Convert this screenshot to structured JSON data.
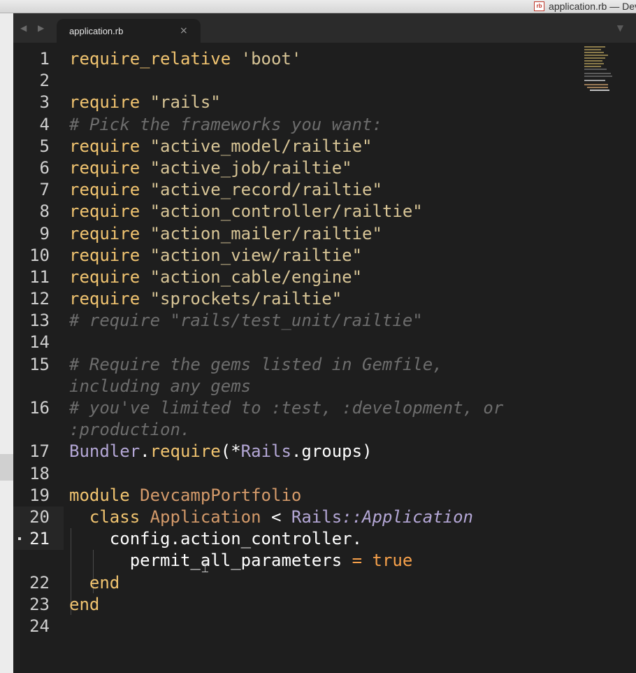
{
  "window": {
    "title": "application.rb — Devc",
    "file_badge": "rb"
  },
  "tabbar": {
    "nav_arrows": "◀ ▶",
    "tab_label": "application.rb",
    "tab_close": "×",
    "menu": "▼"
  },
  "code": {
    "l1": {
      "num": "1",
      "a": "require_relative",
      "b": " 'boot'"
    },
    "l2": {
      "num": "2"
    },
    "l3": {
      "num": "3",
      "a": "require",
      "b": " \"rails\""
    },
    "l4": {
      "num": "4",
      "c": "# Pick the frameworks you want:"
    },
    "l5": {
      "num": "5",
      "a": "require",
      "b": " \"active_model/railtie\""
    },
    "l6": {
      "num": "6",
      "a": "require",
      "b": " \"active_job/railtie\""
    },
    "l7": {
      "num": "7",
      "a": "require",
      "b": " \"active_record/railtie\""
    },
    "l8": {
      "num": "8",
      "a": "require",
      "b": " \"action_controller/railtie\""
    },
    "l9": {
      "num": "9",
      "a": "require",
      "b": " \"action_mailer/railtie\""
    },
    "l10": {
      "num": "10",
      "a": "require",
      "b": " \"action_view/railtie\""
    },
    "l11": {
      "num": "11",
      "a": "require",
      "b": " \"action_cable/engine\""
    },
    "l12": {
      "num": "12",
      "a": "require",
      "b": " \"sprockets/railtie\""
    },
    "l13": {
      "num": "13",
      "c": "# require \"rails/test_unit/railtie\""
    },
    "l14": {
      "num": "14"
    },
    "l15": {
      "num": "15",
      "c": "# Require the gems listed in Gemfile,",
      "c2": "including any gems"
    },
    "l16": {
      "num": "16",
      "c": "# you've limited to :test, :development, or",
      "c2": ":production."
    },
    "l17": {
      "num": "17",
      "a": "Bundler",
      "b": ".",
      "d": "require",
      "e": "(*",
      "f": "Rails",
      "g": ".groups)"
    },
    "l18": {
      "num": "18"
    },
    "l19": {
      "num": "19",
      "a": "module",
      "b": " DevcampPortfolio"
    },
    "l20": {
      "num": "20",
      "a": "class",
      "b": " Application",
      "d": " < ",
      "f": "Rails",
      "g": "::Application"
    },
    "l21": {
      "num": "21",
      "a": "config.action_controller.",
      "b": "permit_all_parameters",
      "d": " = ",
      "e": "true"
    },
    "l22": {
      "num": "22",
      "a": "end"
    },
    "l23": {
      "num": "23",
      "a": "end"
    },
    "l24": {
      "num": "24"
    }
  },
  "colors": {
    "keyword": "#f1c470",
    "string": "#d8c596",
    "comment": "#6d6d6d",
    "class_name": "#d49a6a",
    "constant": "#b4a7d6",
    "boolean": "#f7a14b"
  },
  "icons": {
    "cursor": "text-cursor-icon"
  }
}
